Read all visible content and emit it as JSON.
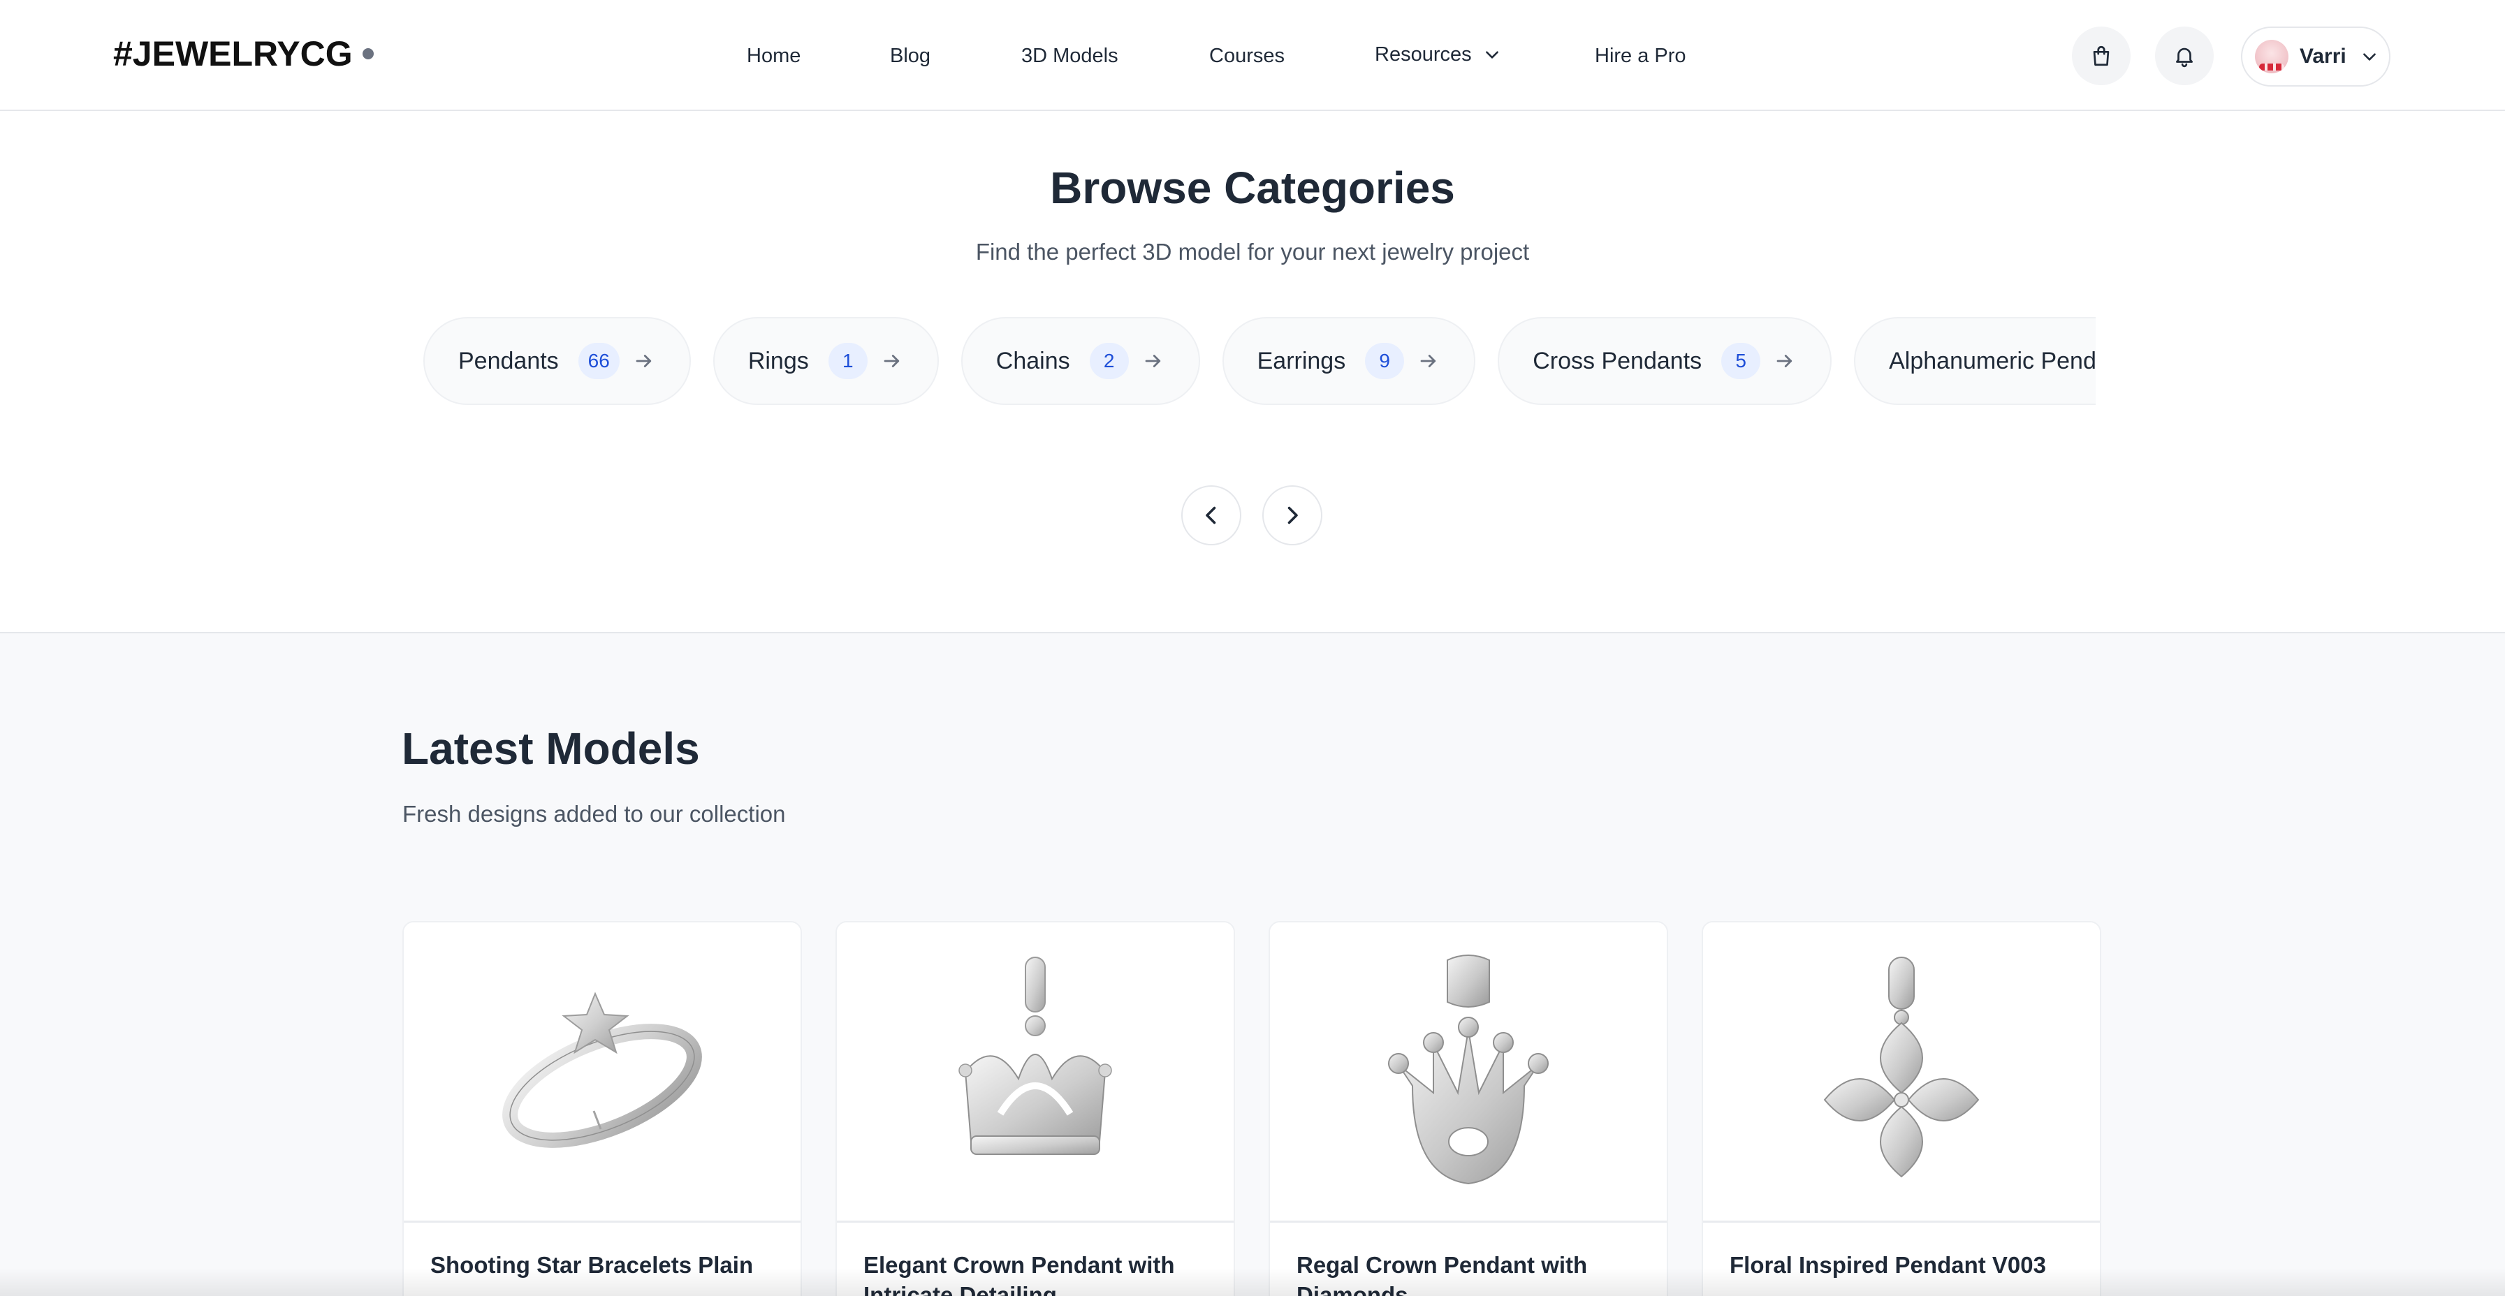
{
  "header": {
    "logo": "#JEWELRYCG",
    "nav": [
      {
        "label": "Home"
      },
      {
        "label": "Blog"
      },
      {
        "label": "3D Models"
      },
      {
        "label": "Courses"
      },
      {
        "label": "Resources"
      },
      {
        "label": "Hire a Pro"
      }
    ],
    "cart_icon": "shopping-bag-icon",
    "notification_icon": "bell-icon",
    "user": {
      "name": "Varri"
    }
  },
  "browse": {
    "title": "Browse Categories",
    "subtitle": "Find the perfect 3D model for your next jewelry project",
    "categories": [
      {
        "name": "Pendants",
        "count": "66"
      },
      {
        "name": "Rings",
        "count": "1"
      },
      {
        "name": "Chains",
        "count": "2"
      },
      {
        "name": "Earrings",
        "count": "9"
      },
      {
        "name": "Cross Pendants",
        "count": "5"
      },
      {
        "name": "Alphanumeric Pendants",
        "count": ""
      }
    ]
  },
  "latest": {
    "title": "Latest Models",
    "subtitle": "Fresh designs added to our collection",
    "cards": [
      {
        "title": "Shooting Star Bracelets Plain"
      },
      {
        "title": "Elegant Crown Pendant with Intricate Detailing"
      },
      {
        "title": "Regal Crown Pendant with Diamonds"
      },
      {
        "title": "Floral Inspired Pendant V003"
      }
    ]
  },
  "colors": {
    "accent_badge_bg": "#e8efff",
    "accent_badge_text": "#1d4ed8",
    "section_bg": "#f8f9fb"
  }
}
